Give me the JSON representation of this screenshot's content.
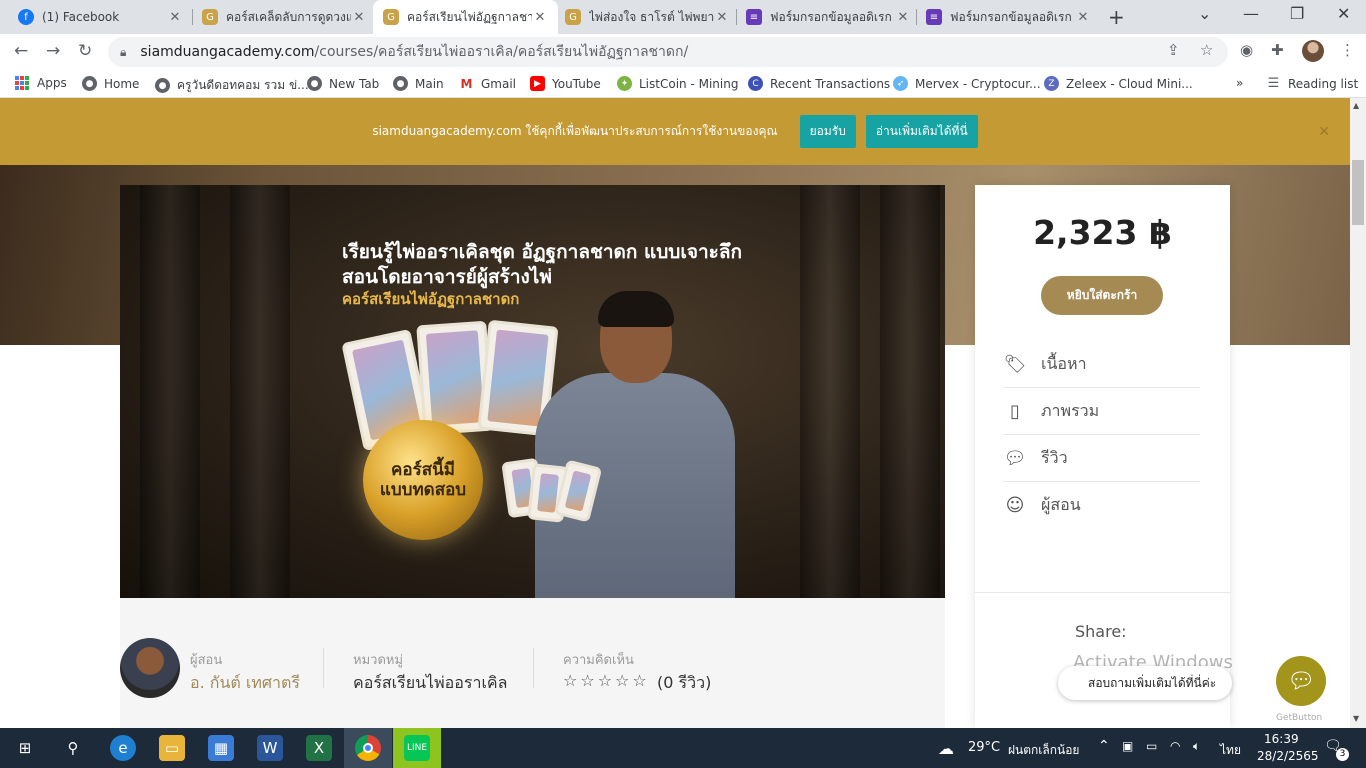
{
  "browser": {
    "tabs": [
      {
        "title": "(1) Facebook",
        "icon": "facebook-icon",
        "active": false
      },
      {
        "title": "คอร์สเคล็ดลับการดูดวงแบบ",
        "icon": "siamduang-icon",
        "active": false
      },
      {
        "title": "คอร์สเรียนไพ่อัฏฐกาลชาดก",
        "icon": "siamduang-icon",
        "active": true
      },
      {
        "title": "ไพ่ส่องใจ ธาโรต์ ไพ่พยากร",
        "icon": "siamduang-icon",
        "active": false
      },
      {
        "title": "ฟอร์มกรอกข้อมูลอดิเรก",
        "icon": "forms-icon",
        "active": false
      },
      {
        "title": "ฟอร์มกรอกข้อมูลอดิเรก",
        "icon": "forms-icon",
        "active": false
      }
    ],
    "url_host": "siamduangacademy.com",
    "url_path": "/courses/คอร์สเรียนไพ่ออราเคิล/คอร์สเรียนไพ่อัฏฐกาลชาดก/",
    "bookmarks": [
      {
        "label": "Apps",
        "icon": "apps-grid-icon"
      },
      {
        "label": "Home",
        "icon": "globe-icon"
      },
      {
        "label": "ครูวันดีดอทคอม รวม ข่...",
        "icon": "globe-icon"
      },
      {
        "label": "New Tab",
        "icon": "globe-icon"
      },
      {
        "label": "Main",
        "icon": "globe-icon"
      },
      {
        "label": "Gmail",
        "icon": "gmail-icon"
      },
      {
        "label": "YouTube",
        "icon": "youtube-icon"
      },
      {
        "label": "ListCoin - Mining",
        "icon": "listcoin-icon"
      },
      {
        "label": "Recent Transactions",
        "icon": "coin-icon"
      },
      {
        "label": "Mervex - Cryptocur...",
        "icon": "mervex-icon"
      },
      {
        "label": "Zeleex - Cloud Mini...",
        "icon": "zeleex-icon"
      }
    ],
    "reading_list": "Reading list",
    "more_bookmarks": "»"
  },
  "cookie": {
    "text": "siamduangacademy.com ใช้คุกกี้เพื่อพัฒนาประสบการณ์การใช้งานของคุณ",
    "accept_label": "ยอมรับ",
    "more_label": "อ่านเพิ่มเติมได้ที่นี่"
  },
  "banner": {
    "line1": "เรียนรู้ไพ่ออราเคิลชุด อัฏฐกาลชาดก แบบเจาะลึก",
    "line2": "สอนโดยอาจารย์ผู้สร้างไพ่",
    "line3": "คอร์สเรียนไพ่อัฏฐกาลชาดก",
    "badge_line1": "คอร์สนี้มี",
    "badge_line2": "แบบทดสอบ"
  },
  "meta": {
    "instructor_label": "ผู้สอน",
    "instructor_name": "อ. กันต์ เทศาตรี",
    "category_label": "หมวดหมู่",
    "category_value": "คอร์สเรียนไพ่ออราเคิล",
    "reviews_label": "ความคิดเห็น",
    "rating": 0,
    "reviews_value": "(0 รีวิว)"
  },
  "sidebar": {
    "price": "2,323 ฿",
    "cart_label": "หยิบใส่ตะกร้า",
    "items": [
      {
        "label": "เนื้อหา",
        "icon": "tag-icon"
      },
      {
        "label": "ภาพรวม",
        "icon": "book-icon"
      },
      {
        "label": "รีวิว",
        "icon": "chat-icon"
      },
      {
        "label": "ผู้สอน",
        "icon": "teacher-icon"
      }
    ],
    "share_label": "Share:"
  },
  "overlay": {
    "activate_windows": "Activate Windows",
    "chat_prompt": "สอบถามเพิ่มเติมได้ที่นี่ค่ะ",
    "getbutton": "GetButton"
  },
  "taskbar": {
    "weather_temp": "29°C",
    "weather_text": "ฝนตกเล็กน้อย",
    "language": "ไทย",
    "time": "16:39",
    "date": "28/2/2565",
    "notification_count": "3"
  },
  "colors": {
    "cookie_bar": "#c49a35",
    "cookie_button": "#17a3a3",
    "cart_button": "#a58a54",
    "chat_button": "#a3941c"
  }
}
